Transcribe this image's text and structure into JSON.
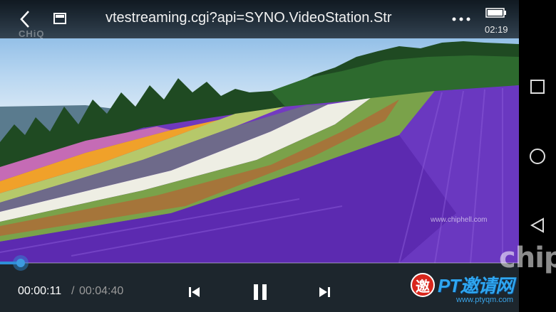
{
  "topbar": {
    "title": "vtestreaming.cgi?api=SYNO.VideoStation.Str",
    "clock": "02:19",
    "icons": {
      "back": "back-chevron-icon",
      "pip": "picture-in-picture-icon",
      "more": "more-dots-icon",
      "battery": "battery-icon"
    }
  },
  "player": {
    "current_time": "00:00:11",
    "separator": "/",
    "total_time": "00:04:40",
    "progress_fraction": 0.04,
    "accent_color": "#2f8fd8",
    "icons": {
      "prev": "skip-previous-icon",
      "pause": "pause-icon",
      "next": "skip-next-icon"
    }
  },
  "navbar": {
    "icons": [
      "recent-apps-square-icon",
      "home-circle-icon",
      "back-triangle-icon"
    ]
  },
  "watermarks": {
    "top_left": "CHiQ",
    "corner_logo": "chip",
    "mid": "www.chiphell.com",
    "pt_badge": "邀",
    "pt_text": "PT邀请网",
    "pt_url": "www.ptyqm.com"
  }
}
